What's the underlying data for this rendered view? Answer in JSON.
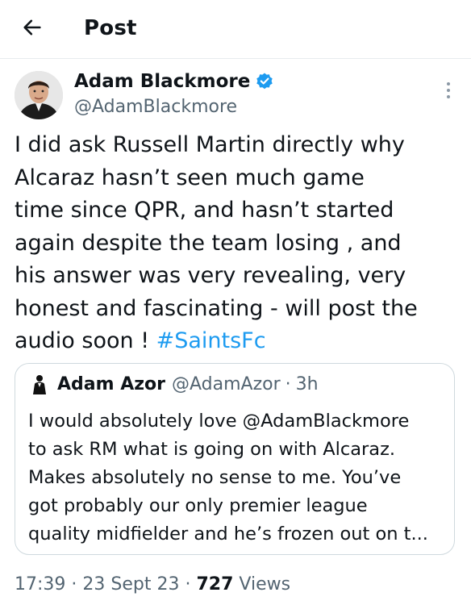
{
  "header": {
    "title": "Post",
    "back_icon": "arrow-left-icon"
  },
  "author": {
    "name": "Adam Blackmore",
    "handle": "@AdamBlackmore",
    "verified": true,
    "verified_color": "#1d9bf0"
  },
  "tweet": {
    "text": "I did ask Russell Martin directly why\nAlcaraz hasn’t seen much game\ntime since QPR, and hasn’t started\nagain despite the team losing , and\nhis answer was very revealing, very\nhonest and fascinating - will post the\naudio soon ! ",
    "hashtag": "#SaintsFc"
  },
  "quote": {
    "name": "Adam Azor",
    "handle": "@AdamAzor",
    "separator": "·",
    "time": "3h",
    "text": "I would absolutely love @AdamBlackmore\nto ask RM what is going on with Alcaraz.\nMakes absolutely no sense to me. You’ve\ngot probably our only premier league\nquality midfielder and he’s frozen out on t..."
  },
  "meta": {
    "time": "17:39",
    "dot1": "·",
    "date": "23 Sept 23",
    "dot2": "·",
    "views_count": "727",
    "views_label": "Views"
  },
  "colors": {
    "accent": "#1d9bf0",
    "secondary_text": "#536471",
    "border": "#cfd9de"
  }
}
